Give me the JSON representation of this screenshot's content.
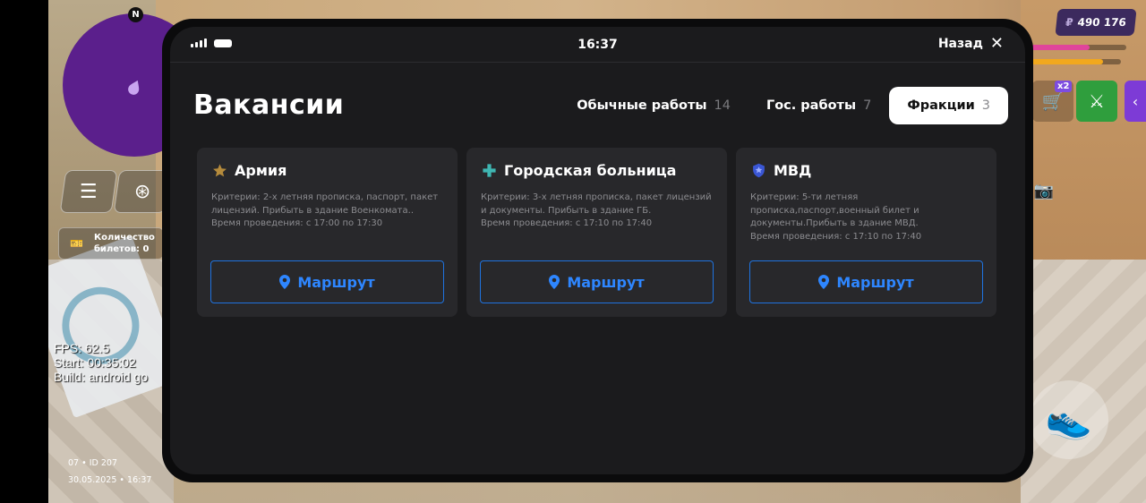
{
  "game_hud": {
    "minimap_north": "N",
    "tickets_label": "Количество\nбилетов: 0",
    "debug": {
      "fps": "FPS: 62.5",
      "start": "Start: 00:35:02",
      "build": "Build: android go"
    },
    "footer": {
      "id_line": "07 • ID 207",
      "date_line": "30.05.2025 • 16:37"
    },
    "money": {
      "currency": "₽",
      "amount": "490 176"
    },
    "bars": [
      {
        "color": "#e0459b",
        "level": 0.65
      },
      {
        "color": "#f2a81d",
        "level": 0.82
      }
    ],
    "shop_badge": "x2"
  },
  "phone": {
    "status": {
      "time": "16:37"
    },
    "back_label": "Назад",
    "title": "Вакансии",
    "tabs": [
      {
        "label": "Обычные работы",
        "count": "14",
        "active": false
      },
      {
        "label": "Гос. работы",
        "count": "7",
        "active": false
      },
      {
        "label": "Фракции",
        "count": "3",
        "active": true
      }
    ],
    "cards": [
      {
        "icon": "star-icon",
        "icon_color": "#b58b3c",
        "title": "Армия",
        "description": "Критерии: 2-х летняя прописка, паспорт, пакет лицензий. Прибыть в здание Военкомата..\nВремя проведения: с 17:00 по 17:30",
        "button": "Маршрут"
      },
      {
        "icon": "medical-cross-icon",
        "icon_color": "#3fb6b2",
        "title": "Городская больница",
        "description": "Критерии: 3-х летняя прописка, пакет лицензий и документы. Прибыть в здание ГБ.\nВремя проведения: с 17:10 по 17:40",
        "button": "Маршрут"
      },
      {
        "icon": "police-badge-icon",
        "icon_color": "#3a56d4",
        "title": "МВД",
        "description": "Критерии: 5-ти летняя прописка,паспорт,военный билет и документы.Прибыть в здание МВД.\nВремя проведения: с 17:10 по 17:40",
        "button": "Маршрут"
      }
    ]
  }
}
